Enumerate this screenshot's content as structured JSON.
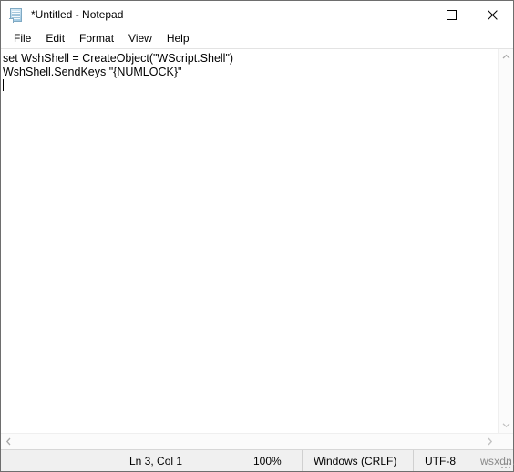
{
  "window": {
    "title": "*Untitled - Notepad",
    "icon": "notepad-icon",
    "controls": {
      "minimize": "minimize-icon",
      "maximize": "maximize-icon",
      "close": "close-icon"
    }
  },
  "menubar": {
    "items": [
      {
        "label": "File"
      },
      {
        "label": "Edit"
      },
      {
        "label": "Format"
      },
      {
        "label": "View"
      },
      {
        "label": "Help"
      }
    ]
  },
  "editor": {
    "lines": [
      "set WshShell = CreateObject(\"WScript.Shell\")",
      "WshShell.SendKeys \"{NUMLOCK}\"",
      ""
    ],
    "caret_line": 3,
    "background": "#ffffff",
    "text_color": "#000000"
  },
  "scrollbars": {
    "vertical": {
      "up": "chevron-up-icon",
      "down": "chevron-down-icon"
    },
    "horizontal": {
      "left": "chevron-left-icon",
      "right": "chevron-right-icon"
    }
  },
  "statusbar": {
    "position": "Ln 3, Col 1",
    "zoom": "100%",
    "line_ending": "Windows (CRLF)",
    "encoding": "UTF-8",
    "watermark": "wsxdn.com",
    "background": "#f0f0f0"
  }
}
